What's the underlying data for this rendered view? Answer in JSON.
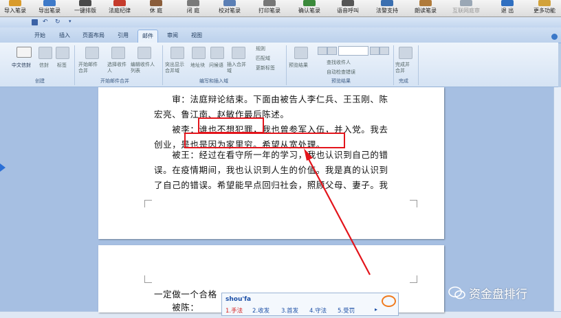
{
  "toolbar": {
    "buttons": [
      {
        "label": "导入笔录",
        "color": "#d99b2b"
      },
      {
        "label": "导出笔录",
        "color": "#3e7ac9"
      },
      {
        "label": "一键排版",
        "color": "#4a4a4a"
      },
      {
        "label": "法庭纪律",
        "color": "#c53b2c"
      },
      {
        "label": "休 庭",
        "color": "#8a5d3b"
      },
      {
        "label": "闭 庭",
        "color": "#7a7a7a"
      },
      {
        "label": "校对笔录",
        "color": "#5b7fb5"
      },
      {
        "label": "打印笔录",
        "color": "#777777"
      },
      {
        "label": "确认笔录",
        "color": "#3b8a3b"
      },
      {
        "label": "语音呼叫",
        "color": "#555555"
      },
      {
        "label": "法警支持",
        "color": "#3b6fb0"
      },
      {
        "label": "朗读笔录",
        "color": "#b07b3b"
      },
      {
        "label": "互联网庭审",
        "color": "#9aa7b5"
      },
      {
        "label": "退 出",
        "color": "#2f6fc0"
      },
      {
        "label": "更多功能",
        "color": "#d2a23a"
      }
    ]
  },
  "word": {
    "tabs": [
      "开始",
      "插入",
      "页面布局",
      "引用",
      "邮件",
      "审阅",
      "视图"
    ],
    "active_tab": "邮件",
    "groups": [
      {
        "label": "创建",
        "items": [
          "中文信封",
          "信封",
          "标签"
        ]
      },
      {
        "label": "开始邮件合并",
        "items": [
          "开始邮件合并",
          "选择收件人",
          "编辑收件人列表"
        ]
      },
      {
        "label": "编写和插入域",
        "items": [
          "突出显示合并域",
          "地址块",
          "问候语",
          "插入合并域",
          "规则",
          "匹配域",
          "更新标签"
        ]
      },
      {
        "label": "预览结果",
        "items": [
          "预览结果",
          "查找收件人",
          "自动检查错误"
        ]
      },
      {
        "label": "完成",
        "items": [
          "完成并合并"
        ]
      }
    ]
  },
  "document": {
    "lines": [
      "　　审：法庭辩论结束。下面由被告人李仁兵、王玉刚、陈",
      "宏亮、鲁江南、赵敏作最后陈述。",
      "　　被李：谁也不想犯罪，我也曾参军入伍，并入党。我去",
      "创业，是也是因为家里穷。希望从宽处理。",
      "　　被王：经过在看守所一年的学习，我也认识到自己的错",
      "误。在疫情期间，我也认识到人生的价值。我是真的认识到",
      "了自己的错误。希望能早点回归社会，照顾父母、妻子。我"
    ],
    "page2_lines": [
      "一定做一个合格",
      "　　被陈："
    ]
  },
  "ime": {
    "pinyin": "shou'fa",
    "candidates": [
      "1.手法",
      "2.收发",
      "3.首发",
      "4.守法",
      "5.受罚"
    ]
  },
  "watermark": "资金盘排行",
  "colors": {
    "annotation": "#e3141b",
    "ribbon_accent": "#3b5a82"
  }
}
